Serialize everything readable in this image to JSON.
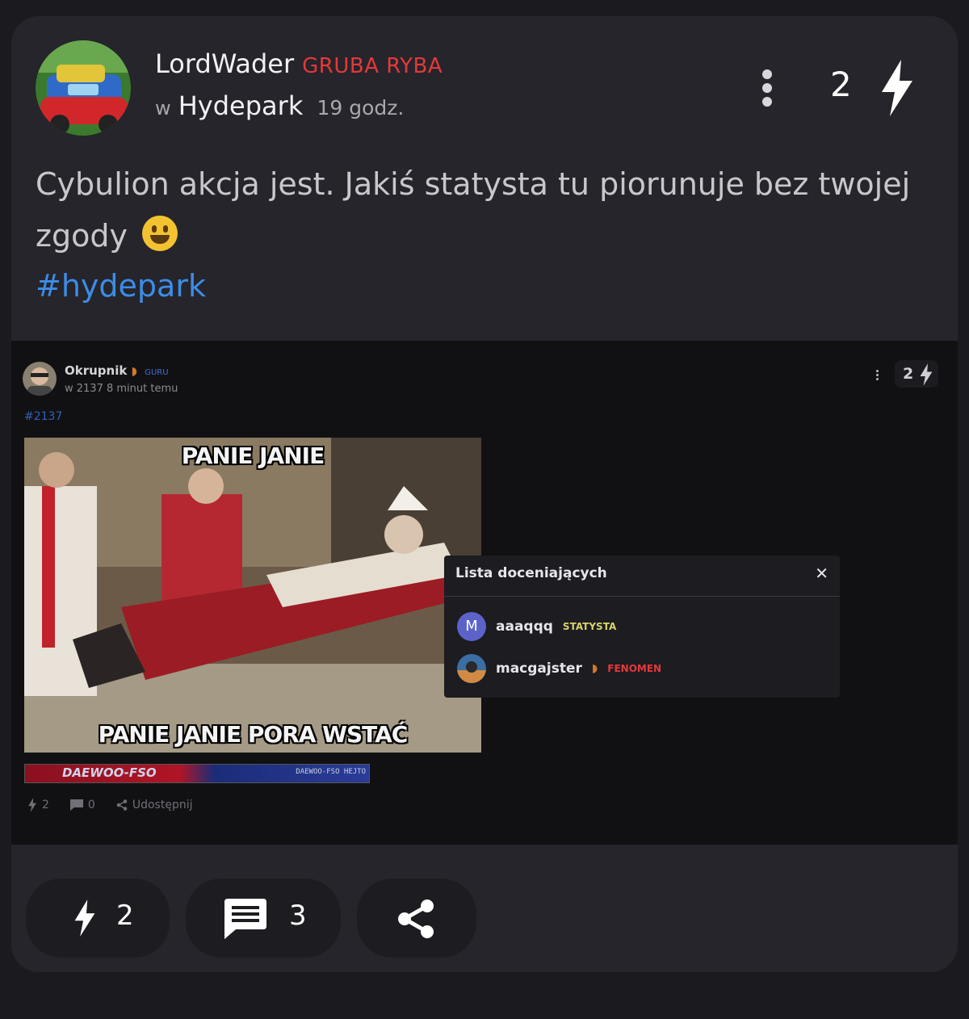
{
  "post": {
    "author": "LordWader",
    "rank": "GRUBA RYBA",
    "in_label": "w",
    "community": "Hydepark",
    "time": "19 godz.",
    "vote_count": "2",
    "content": "Cybulion akcja jest. Jakiś statysta tu piorunuje bez twojej zgody",
    "emoji": "grinning-face",
    "hashtag": "#hydepark"
  },
  "embedded": {
    "author": "Okrupnik",
    "rank": "GURU",
    "sub": "w 2137 8 minut temu",
    "vote_count": "2",
    "hashtag": "#2137",
    "meme_top": "PANIE JANIE",
    "meme_bottom": "PANIE JANIE PORA WSTAĆ",
    "banner_left": "DAEWOO-FSO",
    "banner_right": "DAEWOO-FSO HEJTO",
    "actions": {
      "votes": "2",
      "comments": "0",
      "share": "Udostępnij"
    },
    "popup": {
      "title": "Lista doceniających",
      "users": [
        {
          "initial": "M",
          "name": "aaaqqq",
          "badge": "STATYSTA"
        },
        {
          "name": "macgajster",
          "badge": "FENOMEN"
        }
      ]
    }
  },
  "footer": {
    "votes": "2",
    "comments": "3"
  },
  "colors": {
    "background": "#1a1a1f",
    "card": "#25252b",
    "rank_red": "#e5383b",
    "link_blue": "#3d8ce6"
  }
}
